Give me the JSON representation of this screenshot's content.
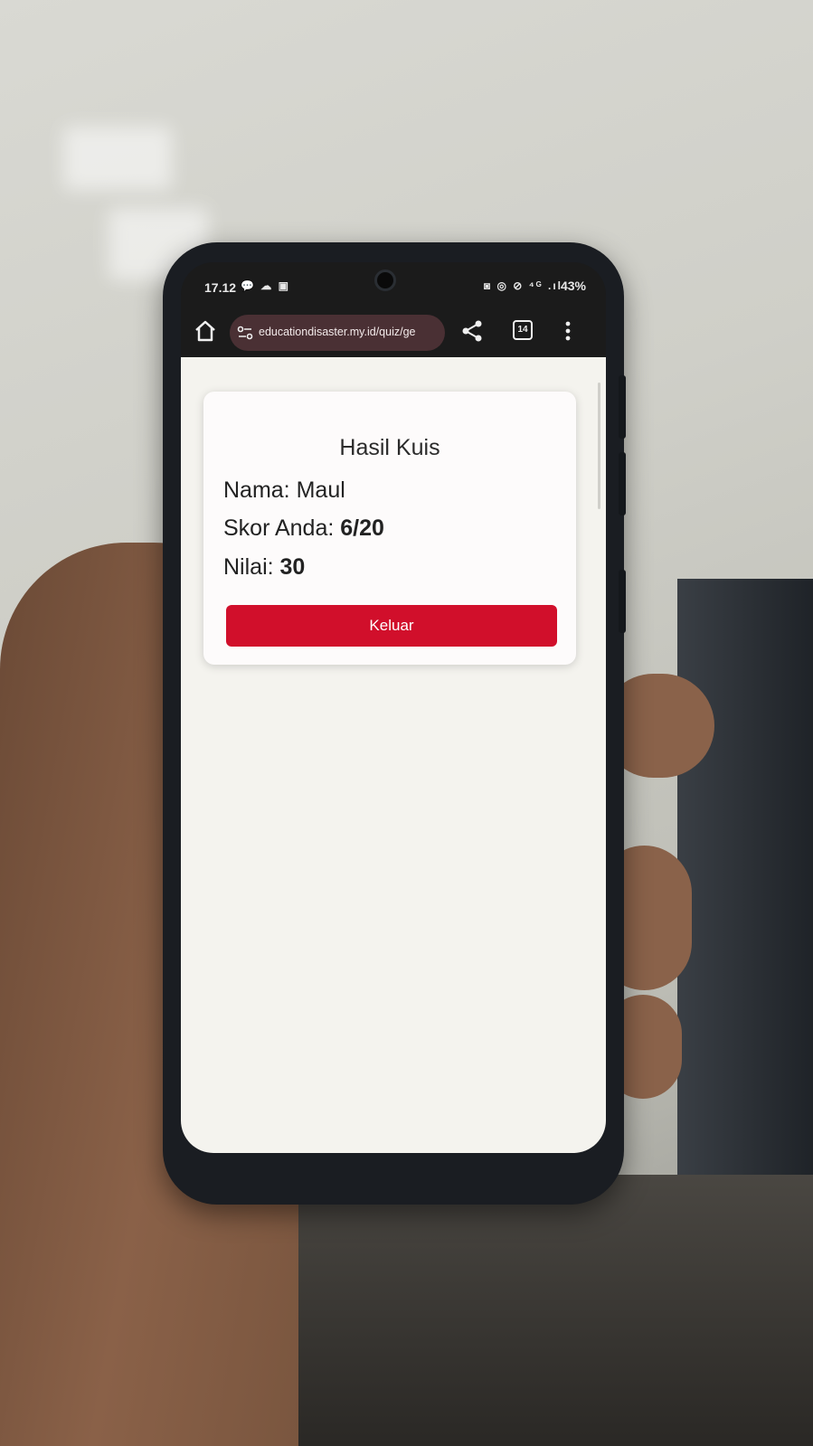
{
  "status_bar": {
    "time": "17.12",
    "notifications": "💬 ☁ ▣",
    "icons": "◙ ◎ ⊘ ⁴ᴳ .ıl",
    "battery": "43%"
  },
  "browser": {
    "url": "educationdisaster.my.id/quiz/ge",
    "tab_count": "14"
  },
  "quiz_result": {
    "title": "Hasil Kuis",
    "name_label": "Nama: ",
    "name_value": "Maul",
    "score_label": "Skor Anda: ",
    "score_value": "6/20",
    "grade_label": "Nilai: ",
    "grade_value": "30",
    "exit_button": "Keluar"
  },
  "colors": {
    "accent": "#d10f2b",
    "url_bar": "#4a3034",
    "page_background": "#f4f3ee"
  },
  "icons": [
    "home-icon",
    "site-settings-icon",
    "share-icon",
    "tabs-icon",
    "more-menu-icon"
  ]
}
